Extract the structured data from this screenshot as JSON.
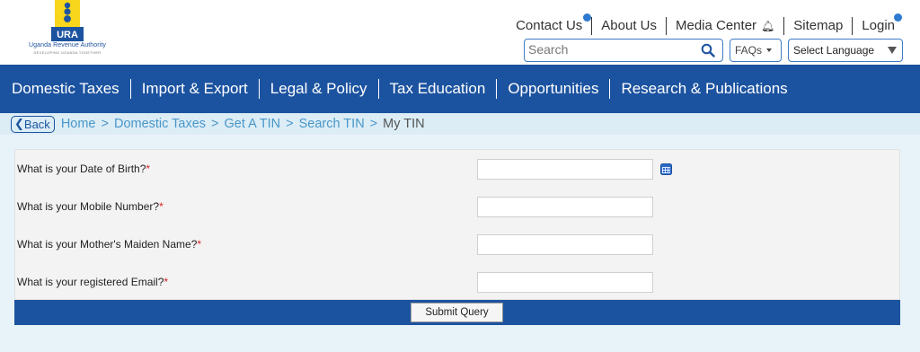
{
  "logo": {
    "name": "Uganda Revenue Authority",
    "tagline": "DEVELOPING UGANDA TOGETHER",
    "abbr": "URA"
  },
  "top_links": [
    {
      "label": "Contact Us",
      "dot": true
    },
    {
      "label": "About Us",
      "dot": false
    },
    {
      "label": "Media Center",
      "dot": false
    },
    {
      "label": "Sitemap",
      "dot": false
    },
    {
      "label": "Login",
      "dot": true
    }
  ],
  "search": {
    "placeholder": "Search"
  },
  "faqs": {
    "label": "FAQs"
  },
  "language": {
    "label": "Select Language"
  },
  "nav": [
    "Domestic Taxes",
    "Import & Export",
    "Legal & Policy",
    "Tax Education",
    "Opportunities",
    "Research & Publications"
  ],
  "breadcrumb": {
    "back_label": "Back",
    "items": [
      "Home",
      "Domestic Taxes",
      "Get A TIN",
      "Search TIN"
    ],
    "current": "My TIN",
    "separator": ">"
  },
  "form": {
    "fields": [
      {
        "label": "What is your Date of Birth?",
        "value": "",
        "has_calendar": true
      },
      {
        "label": "What is your Mobile Number?",
        "value": "",
        "has_calendar": false
      },
      {
        "label": "What is your Mother's Maiden Name?",
        "value": "",
        "has_calendar": false
      },
      {
        "label": "What is your registered Email?",
        "value": "",
        "has_calendar": false
      }
    ],
    "required_marker": "*",
    "submit_label": "Submit Query"
  },
  "colors": {
    "brand_blue": "#1c53a0",
    "link_blue": "#4a96c8",
    "logo_yellow": "#f7d61c",
    "required_red": "#dd2222"
  }
}
